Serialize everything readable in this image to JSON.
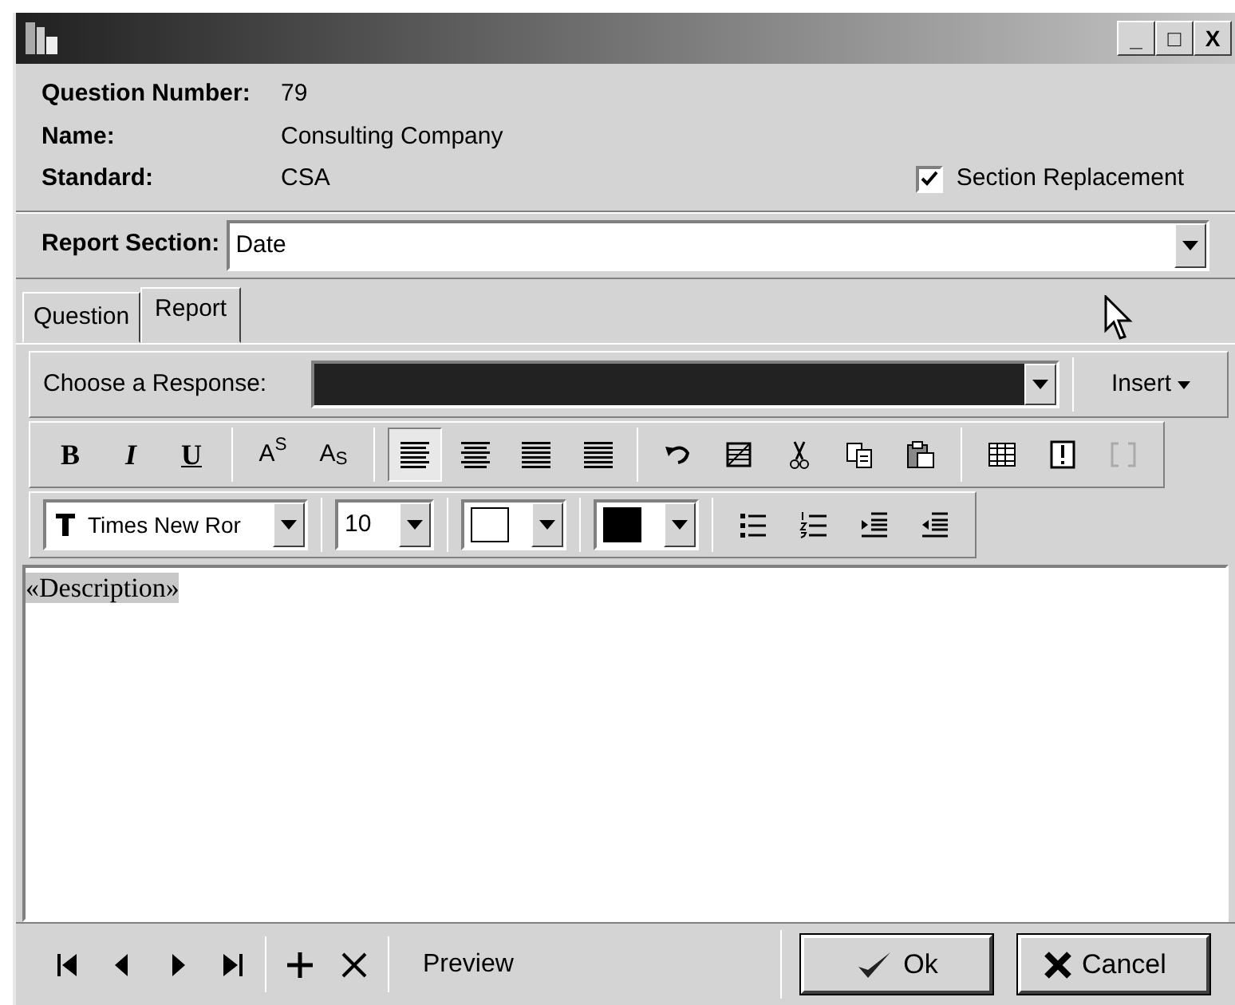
{
  "window": {
    "title_buttons": [
      "_",
      "□",
      "X"
    ]
  },
  "info": [
    {
      "label": "Question Number:",
      "value": "79"
    },
    {
      "label": "Name:",
      "value": "Consulting Company"
    },
    {
      "label": "Standard:",
      "value": "CSA"
    }
  ],
  "section_replacement": {
    "label": "Section Replacement",
    "checked": true
  },
  "report_section": {
    "label": "Report Section:",
    "value": "Date"
  },
  "tabs": [
    {
      "label": "Question",
      "selected": false
    },
    {
      "label": "Report",
      "selected": true
    }
  ],
  "response": {
    "label": "Choose a Response:",
    "highlighted": true,
    "insert": "Insert"
  },
  "format_buttons": [
    {
      "text": "B",
      "kind": "bold"
    },
    {
      "text": "I",
      "kind": "italic"
    },
    {
      "text": "U",
      "kind": "underline"
    },
    {
      "text": "A$^{S}$",
      "kind": "plain"
    },
    {
      "text": "A$_{S}$",
      "kind": "plain"
    }
  ],
  "alignment": [
    {
      "selected": true
    },
    {
      "selected": false
    },
    {
      "selected": false
    },
    {
      "selected": false
    }
  ],
  "font": {
    "value": "Times New Ror",
    "size": "10"
  },
  "color_pickers": [
    {
      "color": "#ffffff"
    },
    {
      "color": "#000000"
    }
  ],
  "editor": {
    "text": "«Description»",
    "highlighted": true
  },
  "footer": {
    "preview": "Preview",
    "ok": "Ok",
    "cancel": "Cancel"
  }
}
